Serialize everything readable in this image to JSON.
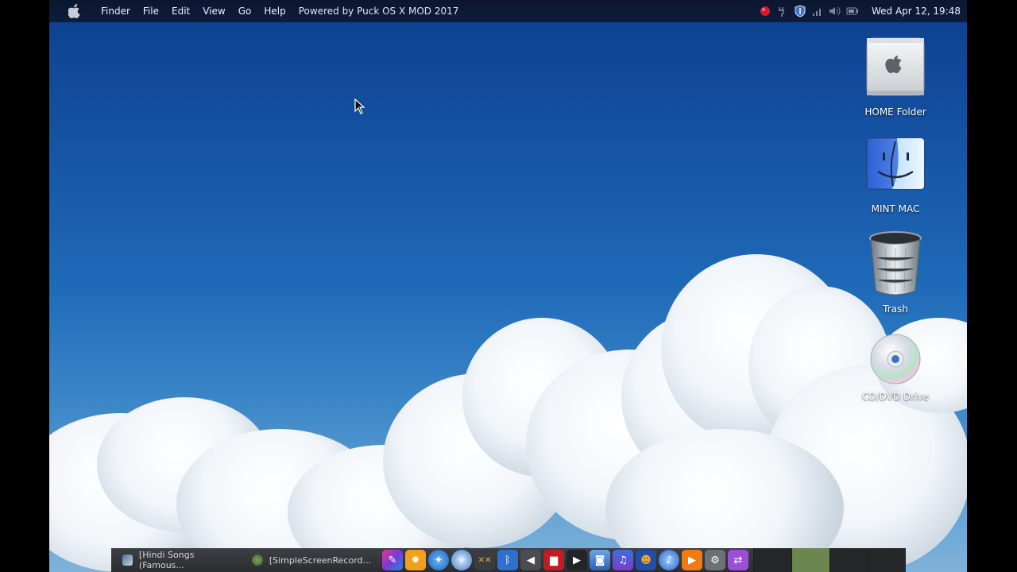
{
  "menubar": {
    "items": [
      "Finder",
      "File",
      "Edit",
      "View",
      "Go",
      "Help"
    ],
    "powered_by": "Powered by  Puck OS X MOD 2017",
    "clock": "Wed Apr 12, 19:48"
  },
  "desktop_icons": [
    {
      "label": "HOME Folder",
      "icon": "mac-pro-icon"
    },
    {
      "label": "MINT MAC",
      "icon": "finder-icon"
    },
    {
      "label": "Trash",
      "icon": "trash-icon"
    },
    {
      "label": "CD/DVD Drive",
      "icon": "cd-icon"
    }
  ],
  "taskbar": {
    "windows": [
      {
        "label": "[Hindi Songs (Famous..."
      },
      {
        "label": "[SimpleScreenRecord..."
      }
    ]
  },
  "colors": {
    "menubar_bg": "#0e1d3c",
    "taskbar_bg": "#2b2d31",
    "active_workspace": "#6c8650"
  }
}
